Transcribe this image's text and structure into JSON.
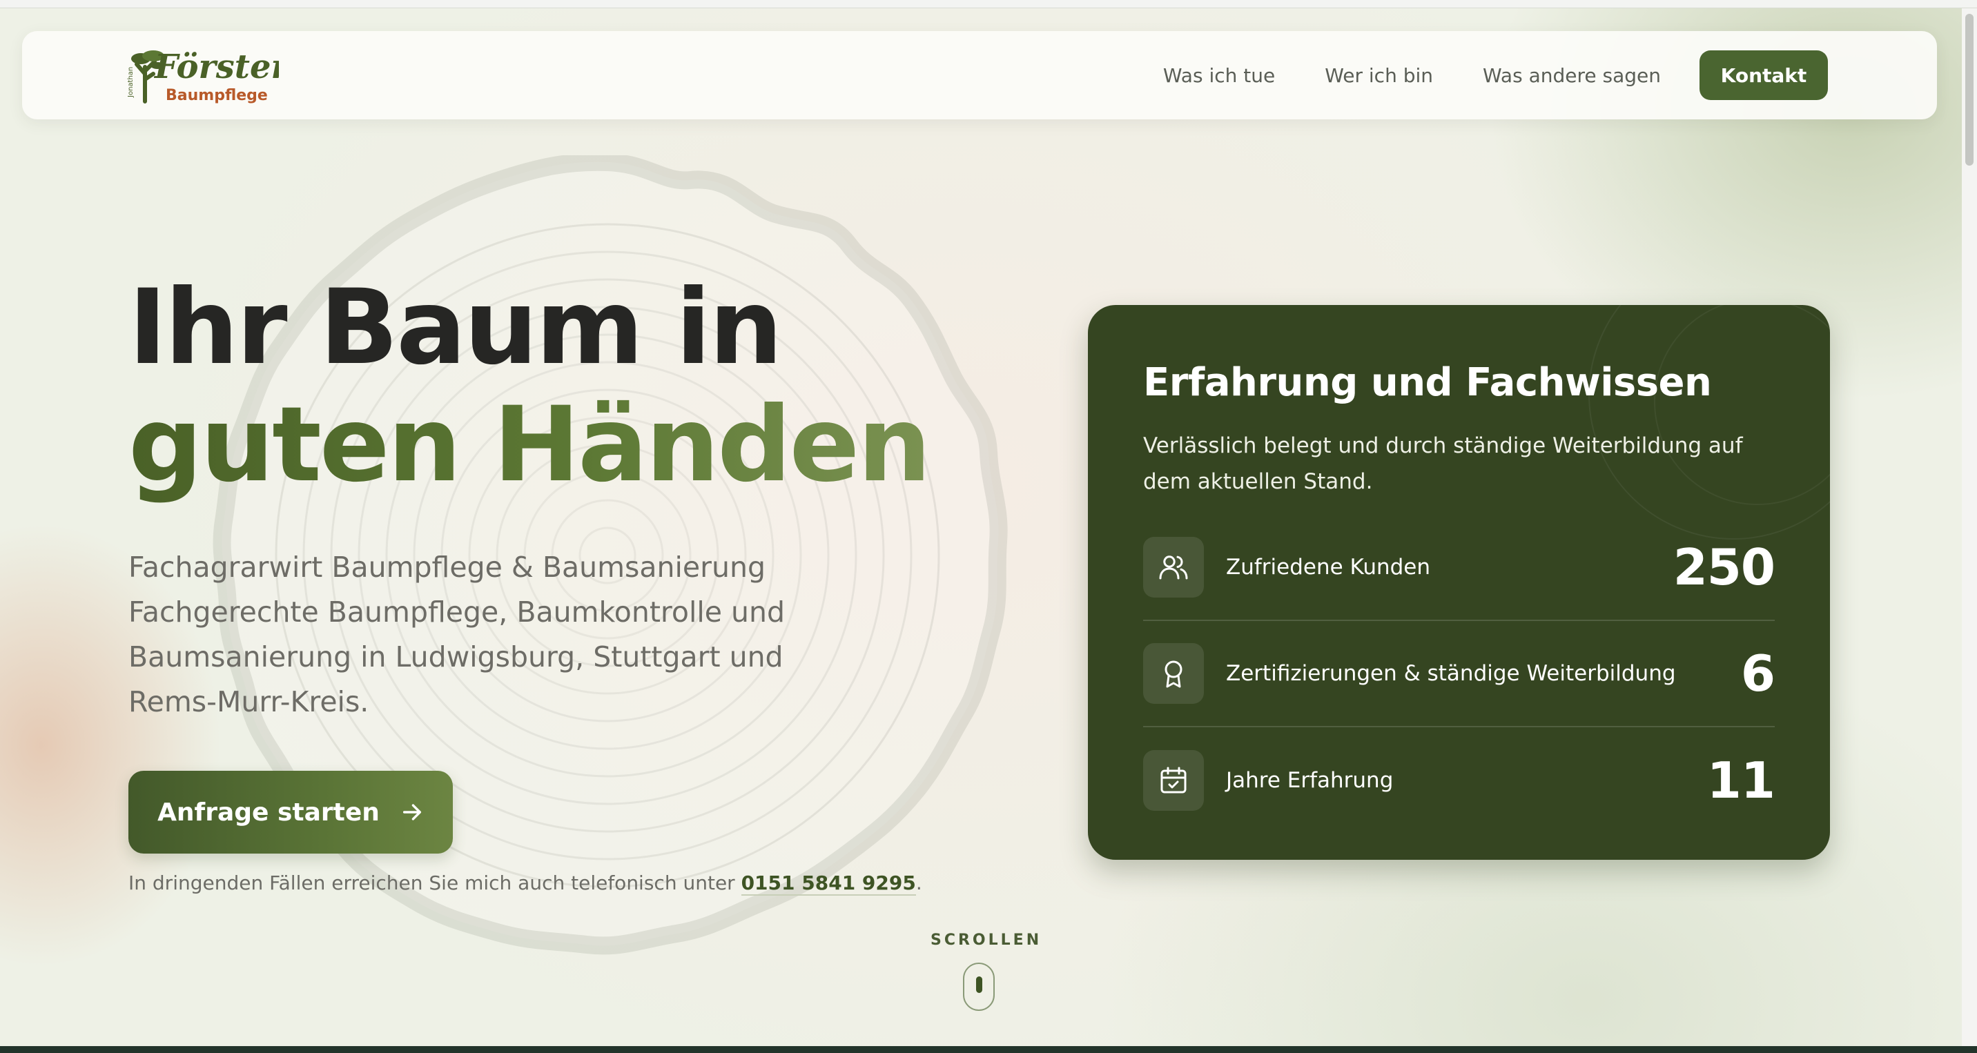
{
  "brand": {
    "name": "Förster",
    "sub": "Baumpflege",
    "first_name": "Jonathan"
  },
  "nav": {
    "items": [
      {
        "label": "Was ich tue"
      },
      {
        "label": "Wer ich bin"
      },
      {
        "label": "Was andere sagen"
      }
    ],
    "contact_label": "Kontakt"
  },
  "hero": {
    "title_line1": "Ihr Baum in",
    "title_line2": "guten Händen",
    "subtitle": "Fachagrarwirt Baumpflege & Baumsanierung Fachgerechte Baumpflege, Baumkontrolle und Baumsanierung in Ludwigsburg, Stuttgart und Rems-Murr-Kreis.",
    "cta_label": "Anfrage starten",
    "urgent_text": "In dringenden Fällen erreichen Sie mich auch telefonisch unter ",
    "phone": "0151 5841 9295",
    "urgent_end": "."
  },
  "scroll": {
    "label": "SCROLLEN"
  },
  "stats_card": {
    "title": "Erfahrung und Fachwissen",
    "description": "Verlässlich belegt und durch ständige Weiterbildung auf dem aktuellen Stand.",
    "items": [
      {
        "icon": "users-icon",
        "label": "Zufriedene Kunden",
        "value": "250"
      },
      {
        "icon": "award-icon",
        "label": "Zertifizierungen & ständige Weiterbildung",
        "value": "6"
      },
      {
        "icon": "calendar-check-icon",
        "label": "Jahre Erfahrung",
        "value": "11"
      }
    ]
  },
  "colors": {
    "primary_green": "#4a6530",
    "card_green": "#354521",
    "heading_dark": "#262624",
    "brand_orange": "#b85a2a"
  }
}
